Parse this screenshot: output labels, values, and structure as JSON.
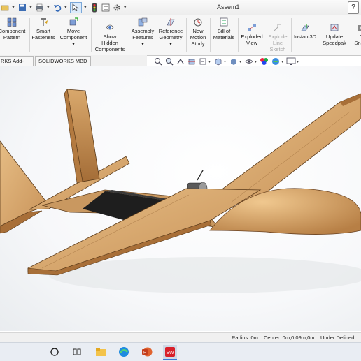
{
  "window": {
    "title": "Assem1",
    "help_label": "?"
  },
  "ribbon": {
    "buttons": [
      {
        "label_line1": "Component",
        "label_line2": "Pattern",
        "icon": "linear-pattern-icon",
        "enabled": true
      },
      {
        "label_line1": "Smart",
        "label_line2": "Fasteners",
        "icon": "smart-fasteners-icon",
        "enabled": true
      },
      {
        "label_line1": "Move",
        "label_line2": "Component",
        "icon": "move-component-icon",
        "enabled": true
      },
      {
        "label_line1": "Show",
        "label_line2": "Hidden",
        "label_line3": "Components",
        "icon": "show-hidden-icon",
        "enabled": true
      },
      {
        "label_line1": "Assembly",
        "label_line2": "Features",
        "icon": "assembly-features-icon",
        "enabled": true
      },
      {
        "label_line1": "Reference",
        "label_line2": "Geometry",
        "icon": "reference-geometry-icon",
        "enabled": true
      },
      {
        "label_line1": "New",
        "label_line2": "Motion",
        "label_line3": "Study",
        "icon": "motion-study-icon",
        "enabled": true
      },
      {
        "label_line1": "Bill of",
        "label_line2": "Materials",
        "icon": "bill-of-materials-icon",
        "enabled": true
      },
      {
        "label_line1": "Exploded",
        "label_line2": "View",
        "icon": "exploded-view-icon",
        "enabled": true
      },
      {
        "label_line1": "Explode",
        "label_line2": "Line",
        "label_line3": "Sketch",
        "icon": "explode-line-icon",
        "enabled": false
      },
      {
        "label_line1": "Instant3D",
        "icon": "instant3d-icon",
        "enabled": true
      },
      {
        "label_line1": "Update",
        "label_line2": "Speedpak",
        "icon": "speedpak-icon",
        "enabled": true
      },
      {
        "label_line1": "T",
        "label_line2": "Snaps",
        "icon": "snapshot-icon",
        "enabled": true
      }
    ]
  },
  "command_tabs": [
    {
      "label": "RKS Add-Ins"
    },
    {
      "label": "SOLIDWORKS MBD"
    }
  ],
  "status": {
    "radius": "Radius: 0m",
    "center": "Center: 0m,0.09m,0m",
    "state": "Under Defined"
  },
  "colors": {
    "wood": "#d4a06a",
    "wood_dark": "#8a5a2b",
    "foam": "#1e1e1e",
    "ribbon_bg": "#f6f6f6"
  }
}
